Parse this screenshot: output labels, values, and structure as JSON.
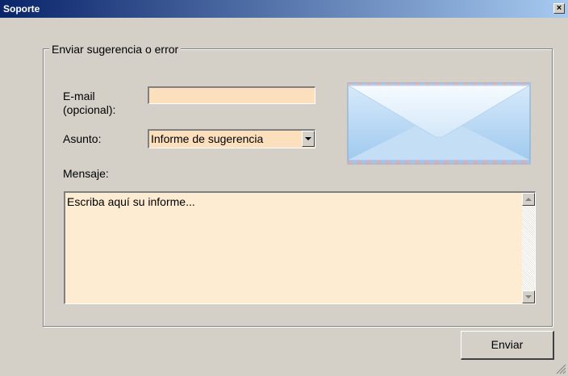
{
  "window": {
    "title": "Soporte",
    "close_icon": "close-icon",
    "close_glyph": "×"
  },
  "group": {
    "title": "Enviar sugerencia o error"
  },
  "form": {
    "email_label_line1": "E-mail",
    "email_label_line2": "(opcional):",
    "email_value": "",
    "subject_label": "Asunto:",
    "subject_selected": "Informe de sugerencia",
    "message_label": "Mensaje:",
    "message_text": "Escriba aquí su informe..."
  },
  "icons": {
    "envelope": "envelope-icon",
    "resize": "resize-grip-icon"
  },
  "buttons": {
    "send_label": "Enviar"
  },
  "colors": {
    "input_background": "#fcdfbd",
    "textarea_background": "#fdebd2",
    "window_background": "#d4d0c8",
    "title_gradient_start": "#0a246a",
    "title_gradient_end": "#a6caf0"
  }
}
